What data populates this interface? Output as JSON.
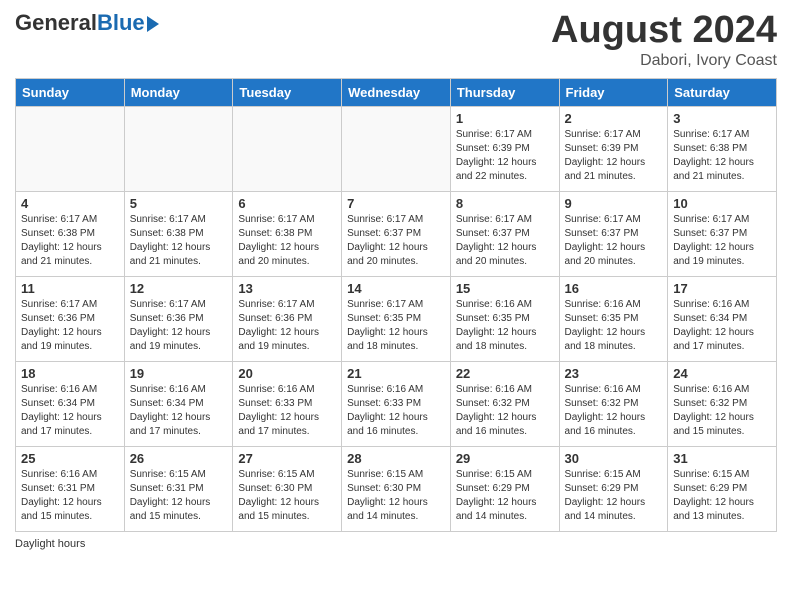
{
  "header": {
    "logo_general": "General",
    "logo_blue": "Blue",
    "month_title": "August 2024",
    "location": "Dabori, Ivory Coast"
  },
  "days_of_week": [
    "Sunday",
    "Monday",
    "Tuesday",
    "Wednesday",
    "Thursday",
    "Friday",
    "Saturday"
  ],
  "weeks": [
    [
      {
        "day": "",
        "info": ""
      },
      {
        "day": "",
        "info": ""
      },
      {
        "day": "",
        "info": ""
      },
      {
        "day": "",
        "info": ""
      },
      {
        "day": "1",
        "info": "Sunrise: 6:17 AM\nSunset: 6:39 PM\nDaylight: 12 hours and 22 minutes."
      },
      {
        "day": "2",
        "info": "Sunrise: 6:17 AM\nSunset: 6:39 PM\nDaylight: 12 hours and 21 minutes."
      },
      {
        "day": "3",
        "info": "Sunrise: 6:17 AM\nSunset: 6:38 PM\nDaylight: 12 hours and 21 minutes."
      }
    ],
    [
      {
        "day": "4",
        "info": "Sunrise: 6:17 AM\nSunset: 6:38 PM\nDaylight: 12 hours and 21 minutes."
      },
      {
        "day": "5",
        "info": "Sunrise: 6:17 AM\nSunset: 6:38 PM\nDaylight: 12 hours and 21 minutes."
      },
      {
        "day": "6",
        "info": "Sunrise: 6:17 AM\nSunset: 6:38 PM\nDaylight: 12 hours and 20 minutes."
      },
      {
        "day": "7",
        "info": "Sunrise: 6:17 AM\nSunset: 6:37 PM\nDaylight: 12 hours and 20 minutes."
      },
      {
        "day": "8",
        "info": "Sunrise: 6:17 AM\nSunset: 6:37 PM\nDaylight: 12 hours and 20 minutes."
      },
      {
        "day": "9",
        "info": "Sunrise: 6:17 AM\nSunset: 6:37 PM\nDaylight: 12 hours and 20 minutes."
      },
      {
        "day": "10",
        "info": "Sunrise: 6:17 AM\nSunset: 6:37 PM\nDaylight: 12 hours and 19 minutes."
      }
    ],
    [
      {
        "day": "11",
        "info": "Sunrise: 6:17 AM\nSunset: 6:36 PM\nDaylight: 12 hours and 19 minutes."
      },
      {
        "day": "12",
        "info": "Sunrise: 6:17 AM\nSunset: 6:36 PM\nDaylight: 12 hours and 19 minutes."
      },
      {
        "day": "13",
        "info": "Sunrise: 6:17 AM\nSunset: 6:36 PM\nDaylight: 12 hours and 19 minutes."
      },
      {
        "day": "14",
        "info": "Sunrise: 6:17 AM\nSunset: 6:35 PM\nDaylight: 12 hours and 18 minutes."
      },
      {
        "day": "15",
        "info": "Sunrise: 6:16 AM\nSunset: 6:35 PM\nDaylight: 12 hours and 18 minutes."
      },
      {
        "day": "16",
        "info": "Sunrise: 6:16 AM\nSunset: 6:35 PM\nDaylight: 12 hours and 18 minutes."
      },
      {
        "day": "17",
        "info": "Sunrise: 6:16 AM\nSunset: 6:34 PM\nDaylight: 12 hours and 17 minutes."
      }
    ],
    [
      {
        "day": "18",
        "info": "Sunrise: 6:16 AM\nSunset: 6:34 PM\nDaylight: 12 hours and 17 minutes."
      },
      {
        "day": "19",
        "info": "Sunrise: 6:16 AM\nSunset: 6:34 PM\nDaylight: 12 hours and 17 minutes."
      },
      {
        "day": "20",
        "info": "Sunrise: 6:16 AM\nSunset: 6:33 PM\nDaylight: 12 hours and 17 minutes."
      },
      {
        "day": "21",
        "info": "Sunrise: 6:16 AM\nSunset: 6:33 PM\nDaylight: 12 hours and 16 minutes."
      },
      {
        "day": "22",
        "info": "Sunrise: 6:16 AM\nSunset: 6:32 PM\nDaylight: 12 hours and 16 minutes."
      },
      {
        "day": "23",
        "info": "Sunrise: 6:16 AM\nSunset: 6:32 PM\nDaylight: 12 hours and 16 minutes."
      },
      {
        "day": "24",
        "info": "Sunrise: 6:16 AM\nSunset: 6:32 PM\nDaylight: 12 hours and 15 minutes."
      }
    ],
    [
      {
        "day": "25",
        "info": "Sunrise: 6:16 AM\nSunset: 6:31 PM\nDaylight: 12 hours and 15 minutes."
      },
      {
        "day": "26",
        "info": "Sunrise: 6:15 AM\nSunset: 6:31 PM\nDaylight: 12 hours and 15 minutes."
      },
      {
        "day": "27",
        "info": "Sunrise: 6:15 AM\nSunset: 6:30 PM\nDaylight: 12 hours and 15 minutes."
      },
      {
        "day": "28",
        "info": "Sunrise: 6:15 AM\nSunset: 6:30 PM\nDaylight: 12 hours and 14 minutes."
      },
      {
        "day": "29",
        "info": "Sunrise: 6:15 AM\nSunset: 6:29 PM\nDaylight: 12 hours and 14 minutes."
      },
      {
        "day": "30",
        "info": "Sunrise: 6:15 AM\nSunset: 6:29 PM\nDaylight: 12 hours and 14 minutes."
      },
      {
        "day": "31",
        "info": "Sunrise: 6:15 AM\nSunset: 6:29 PM\nDaylight: 12 hours and 13 minutes."
      }
    ]
  ],
  "footer": {
    "daylight_label": "Daylight hours"
  }
}
